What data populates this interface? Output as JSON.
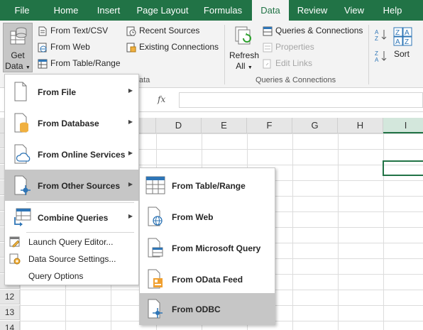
{
  "ribbon_tabs": [
    "File",
    "Home",
    "Insert",
    "Page Layout",
    "Formulas",
    "Data",
    "Review",
    "View",
    "Help"
  ],
  "active_tab": "Data",
  "get_data": {
    "line1": "Get",
    "line2": "Data"
  },
  "get_transform": {
    "from_text_csv": "From Text/CSV",
    "from_web": "From Web",
    "from_table_range": "From Table/Range",
    "recent_sources": "Recent Sources",
    "existing_connections": "Existing Connections",
    "group_label_fragment": "ata"
  },
  "queries": {
    "refresh_line1": "Refresh",
    "refresh_line2": "All",
    "queries_connections": "Queries & Connections",
    "properties": "Properties",
    "edit_links": "Edit Links",
    "group_label": "Queries & Connections"
  },
  "sort": {
    "label": "Sort"
  },
  "formula_bar": {
    "fx": "fx"
  },
  "columns": [
    "D",
    "E",
    "F",
    "G",
    "H",
    "I"
  ],
  "rows": [
    "12",
    "13",
    "14"
  ],
  "menu": {
    "from_file": "From File",
    "from_database": "From Database",
    "from_online_services": "From Online Services",
    "from_other_sources": "From Other Sources",
    "combine_queries": "Combine Queries",
    "launch_query_editor": "Launch Query Editor...",
    "data_source_settings": "Data Source Settings...",
    "query_options": "Query Options"
  },
  "submenu": {
    "from_table_range": "From Table/Range",
    "from_web": "From Web",
    "from_microsoft_query": "From Microsoft Query",
    "from_odata_feed": "From OData Feed",
    "from_odbc": "From ODBC"
  },
  "colors": {
    "accent": "#217346",
    "highlight": "#c6c6c6"
  }
}
